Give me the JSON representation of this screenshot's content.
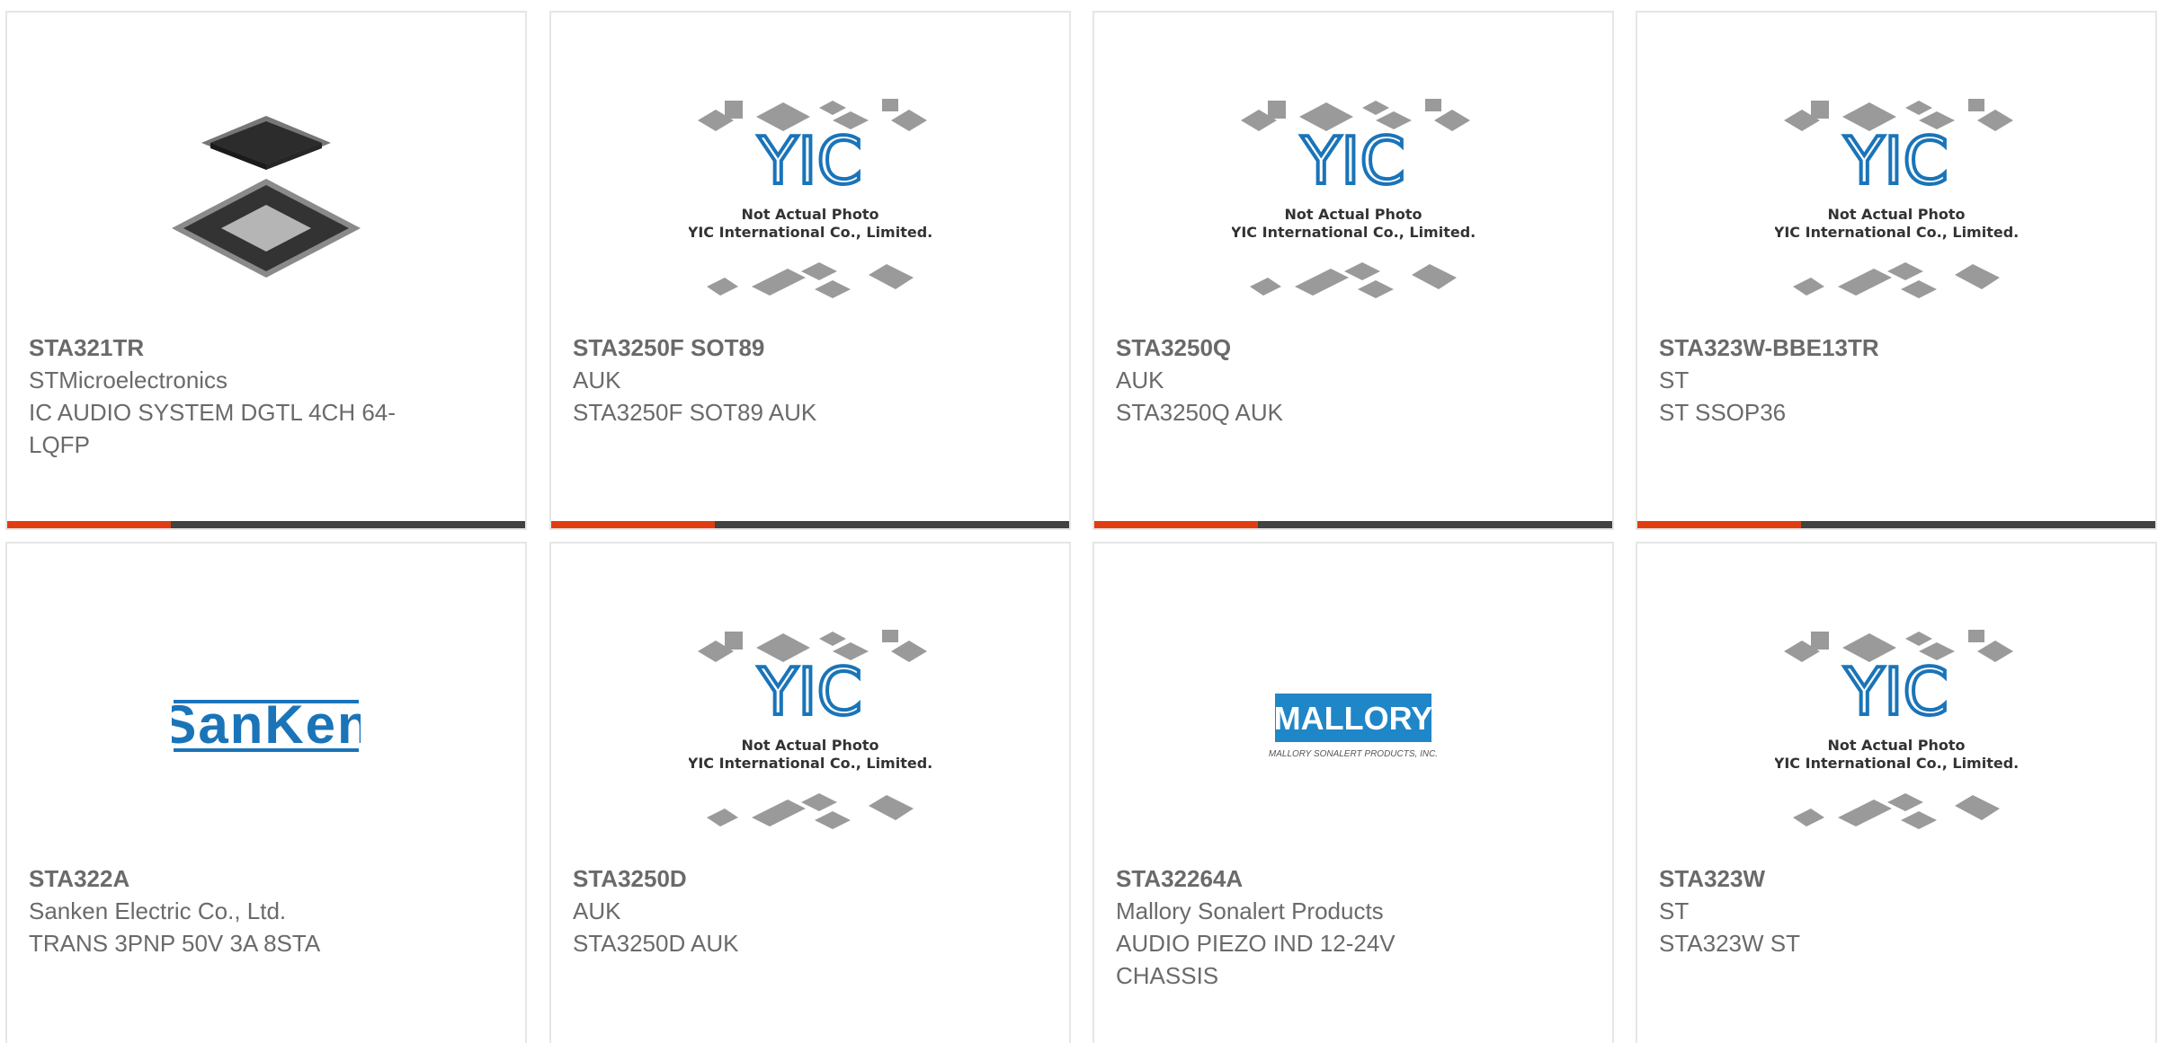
{
  "products": [
    {
      "part": "STA321TR",
      "manufacturer": "STMicroelectronics",
      "description": "IC AUDIO SYSTEM DGTL 4CH 64-LQFP",
      "image": "chip-lqfp-photo",
      "accent_color": "#e23d12"
    },
    {
      "part": "STA3250F SOT89",
      "manufacturer": "AUK",
      "description": "STA3250F SOT89 AUK",
      "image": "yic-placeholder",
      "accent_color": "#e23d12"
    },
    {
      "part": "STA3250Q",
      "manufacturer": "AUK",
      "description": "STA3250Q AUK",
      "image": "yic-placeholder",
      "accent_color": "#e23d12"
    },
    {
      "part": "STA323W-BBE13TR",
      "manufacturer": "ST",
      "description": "ST SSOP36",
      "image": "yic-placeholder",
      "accent_color": "#e23d12"
    },
    {
      "part": "STA322A",
      "manufacturer": "Sanken Electric Co., Ltd.",
      "description": "TRANS 3PNP 50V 3A 8STA",
      "image": "sanken-logo",
      "logo_text": "SanKen"
    },
    {
      "part": "STA3250D",
      "manufacturer": "AUK",
      "description": "STA3250D AUK",
      "image": "yic-placeholder"
    },
    {
      "part": "STA32264A",
      "manufacturer": "Mallory Sonalert Products",
      "description": "AUDIO PIEZO IND 12-24V CHASSIS",
      "image": "mallory-logo",
      "logo_text": "MALLORY",
      "logo_subtext": "MALLORY SONALERT PRODUCTS, INC."
    },
    {
      "part": "STA323W",
      "manufacturer": "ST",
      "description": "STA323W ST",
      "image": "yic-placeholder"
    }
  ],
  "placeholder": {
    "logo_text": "YIC",
    "line1": "Not Actual Photo",
    "line2": "YIC International Co., Limited."
  },
  "colors": {
    "accent": "#e23d12",
    "bar": "#424242",
    "text": "#6a6a6a",
    "border": "#e6e6e6",
    "yic_blue": "#1a74b8",
    "sanken_blue": "#1a74b8",
    "mallory_blue": "#1f86c8"
  }
}
